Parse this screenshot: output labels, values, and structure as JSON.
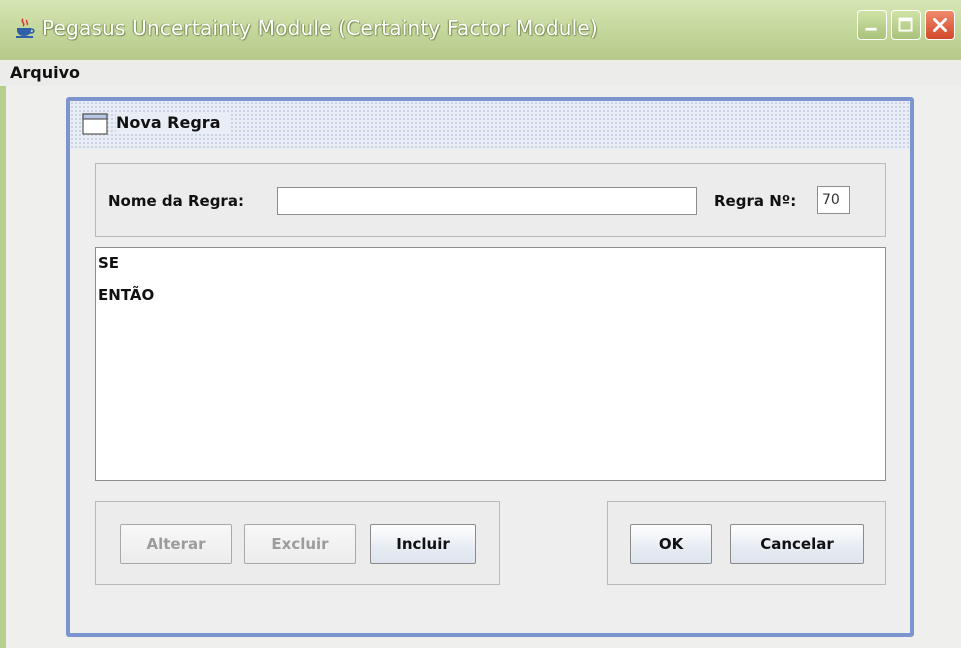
{
  "window": {
    "title": "Pegasus Uncertainty Module (Certainty Factor Module)",
    "icon": "java-cup-icon",
    "controls": [
      "minimize",
      "maximize",
      "close"
    ]
  },
  "menubar": {
    "items": [
      {
        "label": "Arquivo"
      }
    ]
  },
  "dialog": {
    "title": "Nova Regra",
    "name_label": "Nome da Regra:",
    "name_value": "",
    "number_label": "Regra Nº:",
    "number_value": "70",
    "rule_text": {
      "lines": [
        "SE",
        "ENTÃO"
      ]
    },
    "buttons": {
      "alterar": {
        "label": "Alterar",
        "enabled": false
      },
      "excluir": {
        "label": "Excluir",
        "enabled": false
      },
      "incluir": {
        "label": "Incluir",
        "enabled": true
      },
      "ok": {
        "label": "OK",
        "enabled": true
      },
      "cancelar": {
        "label": "Cancelar",
        "enabled": true
      }
    }
  },
  "colors": {
    "titlebar": "#c3d69a",
    "dialog_border": "#7c95cf",
    "close_button": "#d2482a"
  }
}
